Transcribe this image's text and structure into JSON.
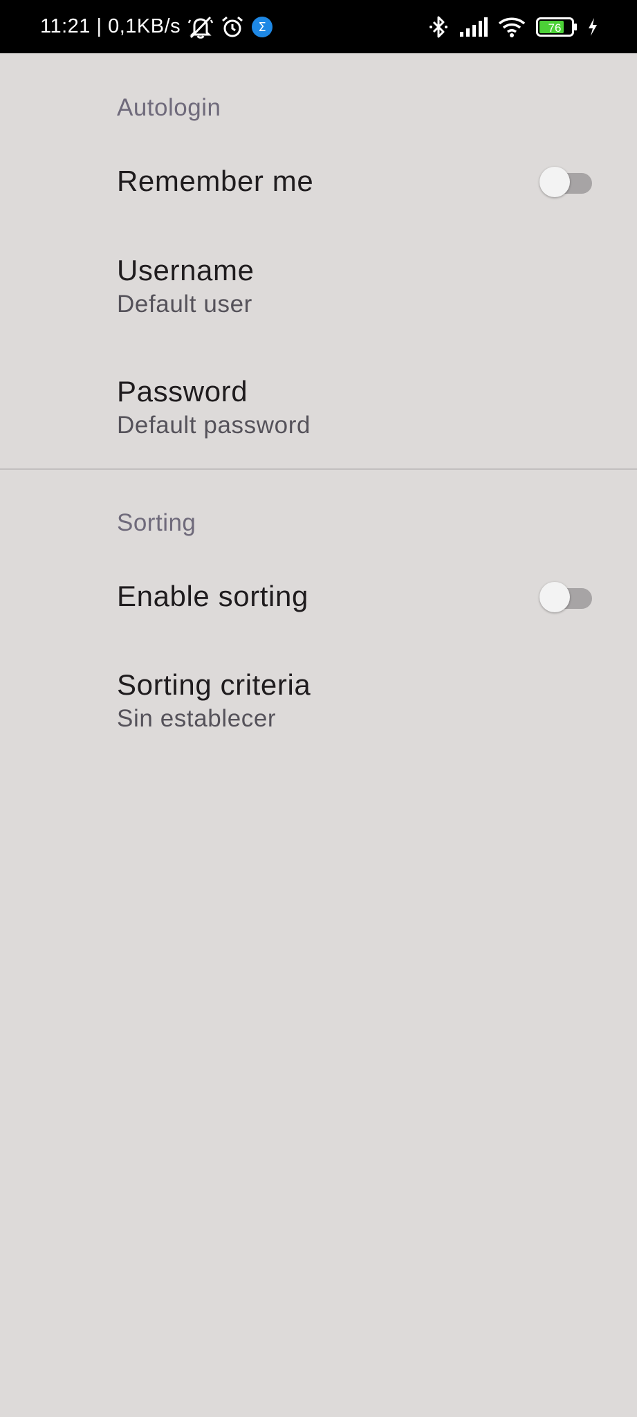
{
  "status_bar": {
    "time_speed": "11:21 | 0,1KB/s",
    "battery_level": "76",
    "icons": [
      "bell-off-icon",
      "alarm-icon",
      "sigma-app-icon",
      "bluetooth-icon",
      "signal-icon",
      "wifi-icon",
      "battery-icon",
      "charging-icon"
    ]
  },
  "sections": {
    "autologin": {
      "header": "Autologin",
      "remember_me": {
        "title": "Remember me",
        "checked": false
      },
      "username": {
        "title": "Username",
        "summary": "Default user"
      },
      "password": {
        "title": "Password",
        "summary": "Default password"
      }
    },
    "sorting": {
      "header": "Sorting",
      "enable_sorting": {
        "title": "Enable sorting",
        "checked": false
      },
      "criteria": {
        "title": "Sorting criteria",
        "summary": "Sin establecer"
      }
    }
  },
  "colors": {
    "background": "#dddad9",
    "section_header": "#6f6a7b",
    "battery_fill": "#4cd137",
    "switch_track_off": "#a7a4a5",
    "switch_thumb_off": "#f3f3f3"
  }
}
